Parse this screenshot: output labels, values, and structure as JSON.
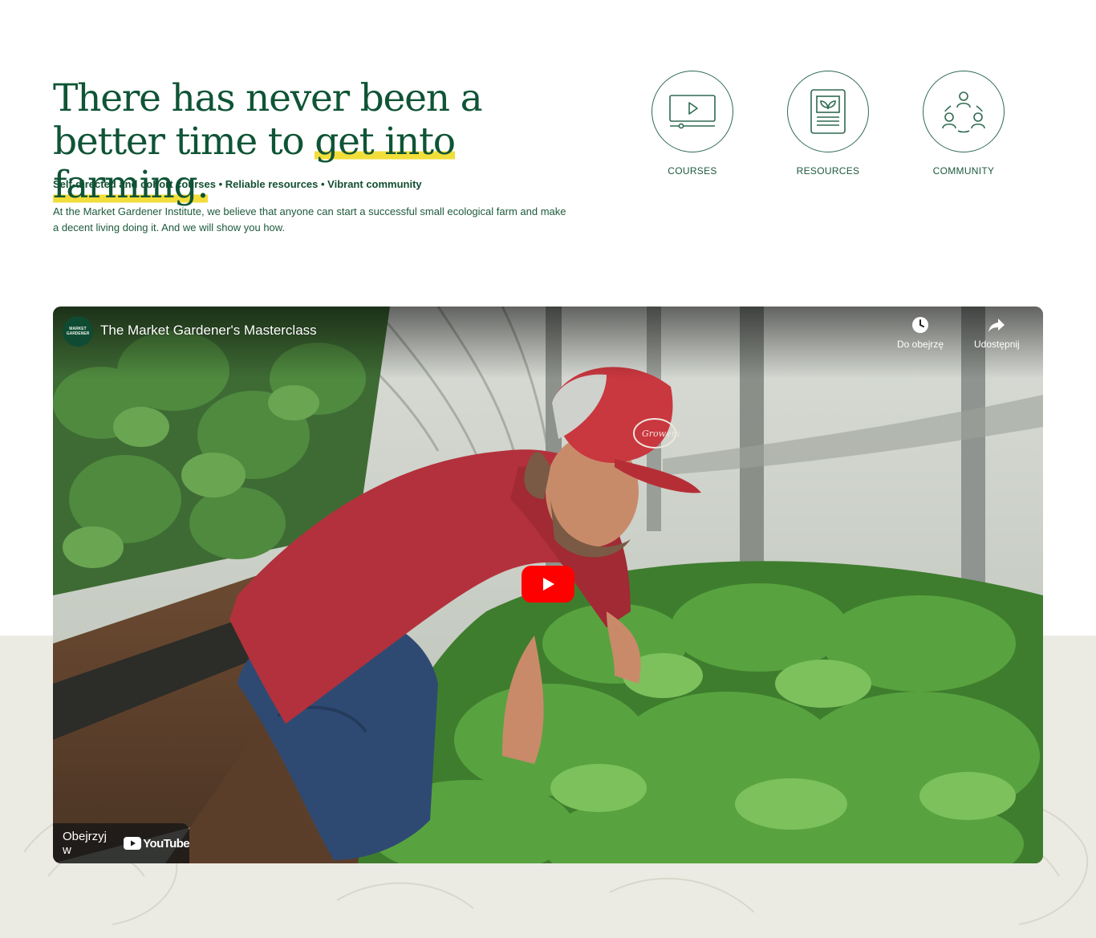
{
  "hero": {
    "title_part1": "There has never been a better time to ",
    "title_highlight": "get into farming.",
    "tagline": "Self-directed and cohort courses • Reliable resources • Vibrant community",
    "intro": "At the Market Gardener Institute, we believe that anyone can start a successful small ecological farm and make a decent living doing it. And we will show you how."
  },
  "features": [
    {
      "label": "COURSES",
      "icon": "video-player-icon"
    },
    {
      "label": "RESOURCES",
      "icon": "document-leaf-icon"
    },
    {
      "label": "COMMUNITY",
      "icon": "community-cycle-icon"
    }
  ],
  "video": {
    "channel_avatar_text": "MARKET GARDENER",
    "title": "The Market Gardener's Masterclass",
    "watch_later_label": "Do obejrzę",
    "share_label": "Udostępnij",
    "watch_on_label": "Obejrzyj w",
    "youtube_wordmark": "YouTube",
    "cap_text": "Growers"
  },
  "colors": {
    "brand_green": "#0f5436",
    "highlight_yellow": "#f2de3a",
    "youtube_red": "#ff0000",
    "band_beige": "#ecebe3"
  }
}
